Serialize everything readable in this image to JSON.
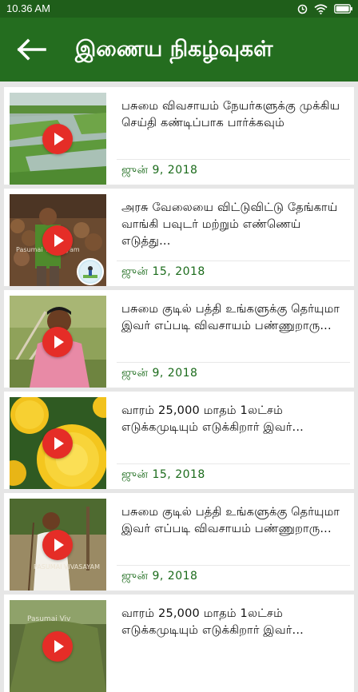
{
  "status": {
    "time": "10.36 AM"
  },
  "header": {
    "title": "இணைய நிகழ்வுகள்"
  },
  "items": [
    {
      "title": "பசுமை விவசாயம் நேயர்களுக்கு முக்கிய செய்தி கண்டிப்பாக பார்க்கவும்",
      "date": "ஜுன் 9, 2018"
    },
    {
      "title": "அரசு வேலையை விட்டுவிட்டு தேங்காய் வாங்கி பவுடர் மற்றும் எண்ணெய் எடுத்து...",
      "date": "ஜுன் 15, 2018"
    },
    {
      "title": "பசுமை குடில் பத்தி உங்களுக்கு தெர்யுமா இவர் எப்படி விவசாயம் பண்ணுறாரு...",
      "date": "ஜுன் 9, 2018"
    },
    {
      "title": "வாரம் 25,000 மாதம் 1லட்சம் எடுக்கமுடியும் எடுக்கிறார் இவர்...",
      "date": "ஜுன் 15, 2018"
    },
    {
      "title": "பசுமை குடில் பத்தி உங்களுக்கு தெர்யுமா இவர் எப்படி விவசாயம் பண்ணுறாரு...",
      "date": "ஜுன் 9, 2018"
    },
    {
      "title": "வாரம் 25,000 மாதம் 1லட்சம் எடுக்கமுடியும் எடுக்கிறார் இவர்...",
      "date": ""
    }
  ],
  "colors": {
    "appbar": "#246d1f",
    "statusbar": "#1f5e1a",
    "date": "#1b6b1b",
    "play": "#e52d27"
  }
}
